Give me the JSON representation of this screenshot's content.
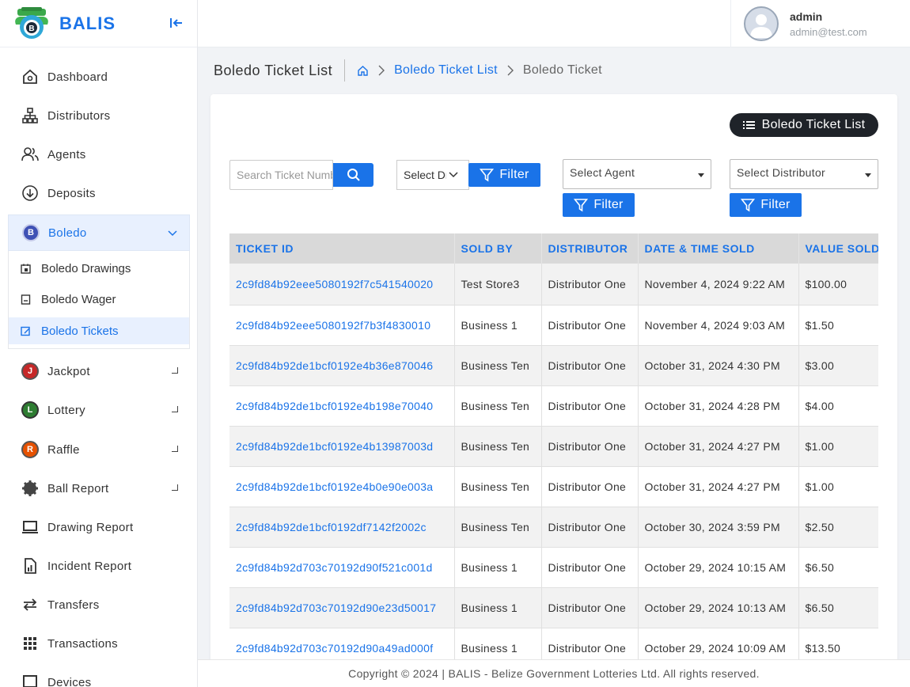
{
  "app": {
    "name": "BALIS"
  },
  "sidebar": {
    "items": [
      {
        "label": "Dashboard",
        "icon": "home-icon"
      },
      {
        "label": "Distributors",
        "icon": "sitemap-icon"
      },
      {
        "label": "Agents",
        "icon": "users-icon"
      },
      {
        "label": "Deposits",
        "icon": "deposit-icon"
      },
      {
        "label": "Boledo",
        "icon": "boledo-icon",
        "badge": "B"
      },
      {
        "label": "Jackpot",
        "icon": "jackpot-icon",
        "badge": "J"
      },
      {
        "label": "Lottery",
        "icon": "lottery-icon",
        "badge": "L"
      },
      {
        "label": "Raffle",
        "icon": "raffle-icon",
        "badge": "R"
      },
      {
        "label": "Ball Report",
        "icon": "gear-icon"
      },
      {
        "label": "Drawing Report",
        "icon": "monitor-icon"
      },
      {
        "label": "Incident Report",
        "icon": "report-icon"
      },
      {
        "label": "Transfers",
        "icon": "transfer-icon"
      },
      {
        "label": "Transactions",
        "icon": "grid-icon"
      },
      {
        "label": "Devices",
        "icon": "device-icon"
      }
    ],
    "boledo_sub": [
      {
        "label": "Boledo Drawings"
      },
      {
        "label": "Boledo Wager"
      },
      {
        "label": "Boledo Tickets"
      }
    ]
  },
  "user": {
    "name": "admin",
    "email": "admin@test.com"
  },
  "header": {
    "title": "Boledo Ticket List",
    "breadcrumb_link": "Boledo Ticket List",
    "breadcrumb_current": "Boledo Ticket"
  },
  "toolbar": {
    "list_button": "Boledo Ticket List",
    "search_placeholder": "Search Ticket Number",
    "select_drawing": "Select Drawing",
    "filter_label": "Filter",
    "select_agent": "Select Agent",
    "select_distributor": "Select Distributor"
  },
  "table": {
    "columns": [
      "TICKET ID",
      "SOLD BY",
      "DISTRIBUTOR",
      "DATE & TIME SOLD",
      "VALUE SOLD"
    ],
    "rows": [
      [
        "2c9fd84b92eee5080192f7c541540020",
        "Test Store3",
        "Distributor One",
        "November 4, 2024 9:22 AM",
        "$100.00"
      ],
      [
        "2c9fd84b92eee5080192f7b3f4830010",
        "Business 1",
        "Distributor One",
        "November 4, 2024 9:03 AM",
        "$1.50"
      ],
      [
        "2c9fd84b92de1bcf0192e4b36e870046",
        "Business Ten",
        "Distributor One",
        "October 31, 2024 4:30 PM",
        "$3.00"
      ],
      [
        "2c9fd84b92de1bcf0192e4b198e70040",
        "Business Ten",
        "Distributor One",
        "October 31, 2024 4:28 PM",
        "$4.00"
      ],
      [
        "2c9fd84b92de1bcf0192e4b13987003d",
        "Business Ten",
        "Distributor One",
        "October 31, 2024 4:27 PM",
        "$1.00"
      ],
      [
        "2c9fd84b92de1bcf0192e4b0e90e003a",
        "Business Ten",
        "Distributor One",
        "October 31, 2024 4:27 PM",
        "$1.00"
      ],
      [
        "2c9fd84b92de1bcf0192df7142f2002c",
        "Business Ten",
        "Distributor One",
        "October 30, 2024 3:59 PM",
        "$2.50"
      ],
      [
        "2c9fd84b92d703c70192d90f521c001d",
        "Business 1",
        "Distributor One",
        "October 29, 2024 10:15 AM",
        "$6.50"
      ],
      [
        "2c9fd84b92d703c70192d90e23d50017",
        "Business 1",
        "Distributor One",
        "October 29, 2024 10:13 AM",
        "$6.50"
      ],
      [
        "2c9fd84b92d703c70192d90a49ad000f",
        "Business 1",
        "Distributor One",
        "October 29, 2024 10:09 AM",
        "$13.50"
      ]
    ]
  },
  "footer": {
    "text": "Copyright © 2024 | BALIS - Belize Government Lotteries Ltd. All rights reserved."
  },
  "colors": {
    "accent": "#1a73e8",
    "dark_button": "#1f2329",
    "header_bg": "#d9d9d9"
  }
}
